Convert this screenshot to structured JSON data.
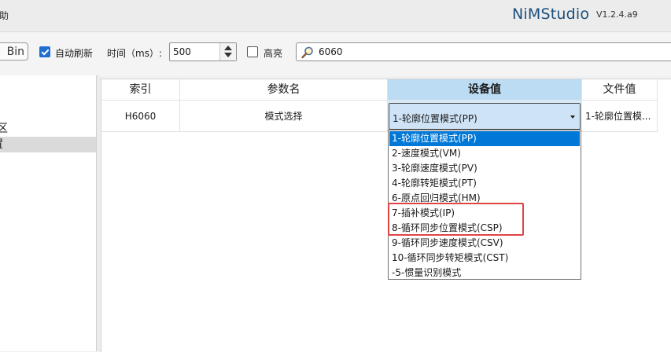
{
  "app": {
    "menu_help": "助",
    "brand": "NiMStudio",
    "version": "V1.2.4.a9"
  },
  "toolbar": {
    "bin_label": "Bin",
    "auto_refresh_label": "自动刷新",
    "auto_refresh_checked": true,
    "interval_label": "时间（ms）:",
    "interval_value": "500",
    "highlight_label": "高亮",
    "highlight_checked": false,
    "search_value": "6060"
  },
  "tree": {
    "items": [
      {
        "label": "区"
      },
      {
        "label": "置"
      }
    ]
  },
  "grid": {
    "columns": [
      "索引",
      "参数名",
      "设备值",
      "文件值"
    ],
    "selected_column": "设备值",
    "row": {
      "index": "H6060",
      "name": "模式选择",
      "device_value": "1-轮廓位置模式(PP)",
      "file_value": "1-轮廓位置模..."
    }
  },
  "dropdown": {
    "options": [
      "1-轮廓位置模式(PP)",
      "2-速度模式(VM)",
      "3-轮廓速度模式(PV)",
      "4-轮廓转矩模式(PT)",
      "6-原点回归模式(HM)",
      "7-插补模式(IP)",
      "8-循环同步位置模式(CSP)",
      "9-循环同步速度模式(CSV)",
      "10-循环同步转矩模式(CST)",
      "-5-惯量识别模式"
    ],
    "selected_index": 0
  },
  "colors": {
    "accent": "#0078d7",
    "header_selected": "#bcdcf4",
    "annotation_red": "#e04545"
  }
}
